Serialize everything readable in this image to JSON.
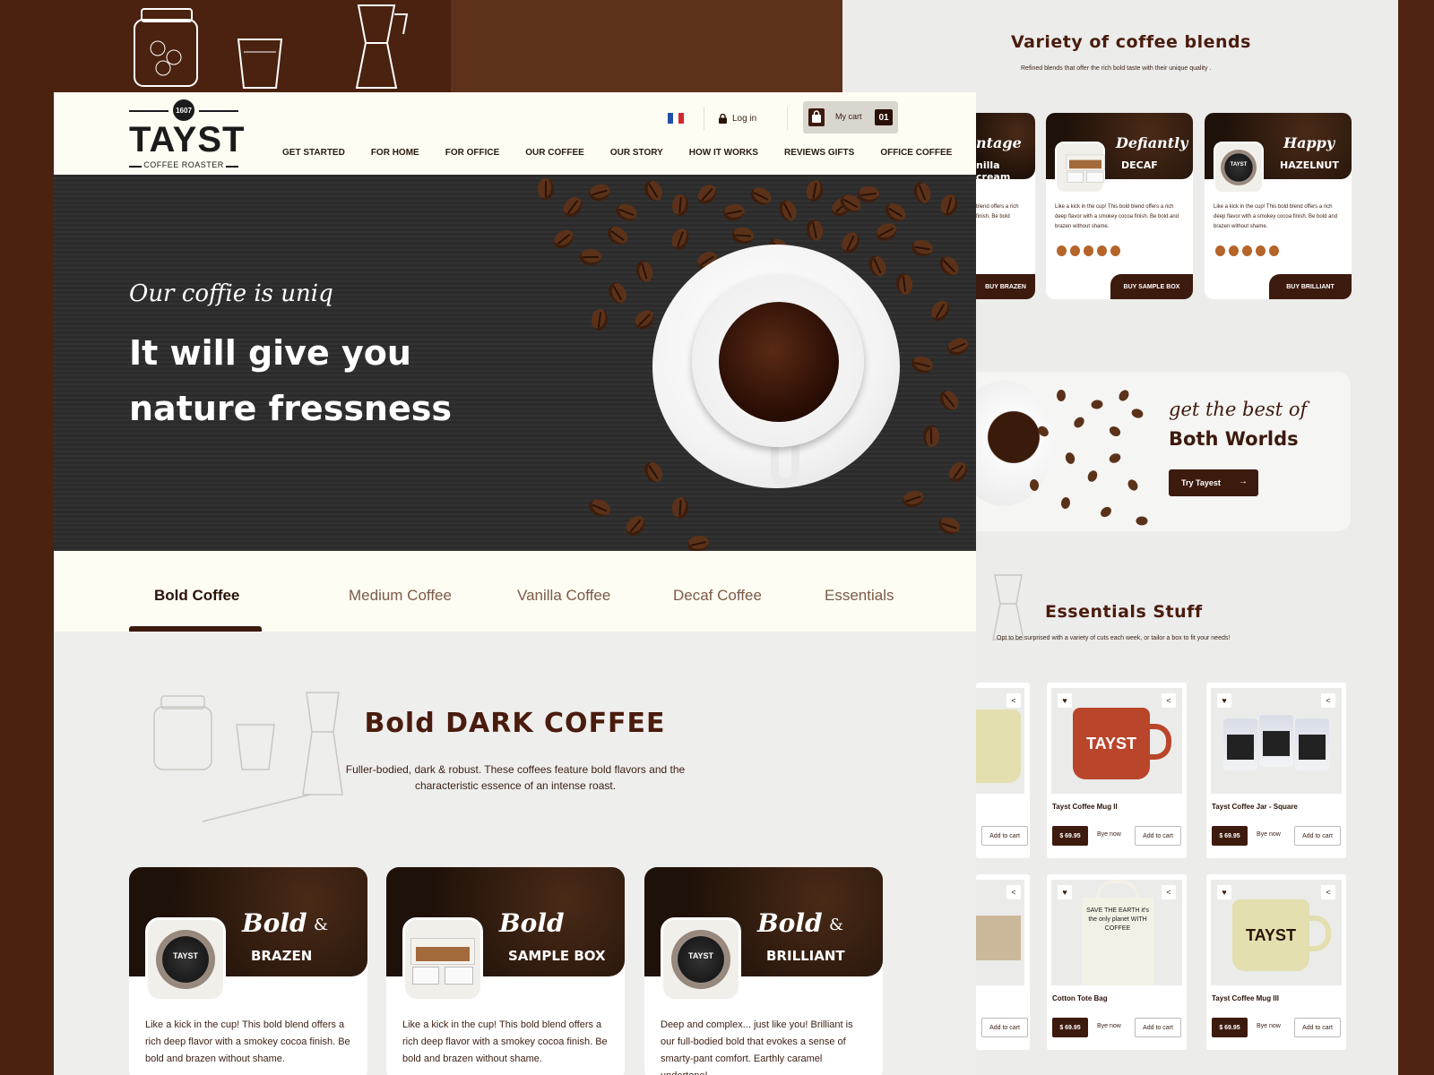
{
  "header": {
    "logo": {
      "badge": "1607",
      "name": "TAYST",
      "tagline": "COFFEE ROASTER"
    },
    "login_label": "Log in",
    "cart": {
      "label": "My cart",
      "count": "01"
    },
    "nav": [
      "GET STARTED",
      "FOR HOME",
      "FOR OFFICE",
      "OUR COFFEE",
      "OUR STORY",
      "HOW IT WORKS",
      "REVIEWS GIFTS",
      "OFFICE COFFEE"
    ]
  },
  "hero": {
    "tagline": "Our coffie is uniq",
    "headline": "It will give you nature fressness"
  },
  "tabs": [
    "Bold Coffee",
    "Medium Coffee",
    "Vanilla Coffee",
    "Decaf Coffee",
    "Essentials"
  ],
  "bold_section": {
    "title": "Bold  DARK COFFEE",
    "description": "Fuller-bodied, dark & robust. These coffees feature bold flavors and the characteristic essence of an intense roast.",
    "cards": [
      {
        "script": "Bold",
        "amp": "&",
        "name": "BRAZEN",
        "description": "Like a kick in the cup!  This bold blend offers a rich deep flavor with a smokey cocoa finish.  Be bold and brazen without shame."
      },
      {
        "script": "Bold",
        "amp": "",
        "name": "SAMPLE BOX",
        "description": "Like a kick in the cup!  This bold blend offers a rich deep flavor with a smokey cocoa finish.  Be bold and brazen without shame."
      },
      {
        "script": "Bold",
        "amp": "&",
        "name": "BRILLIANT",
        "description": "Deep and complex... just like you!  Brilliant is our full-bodied bold that evokes a sense of smarty-pant comfort. Earthly caramel undertone!"
      }
    ]
  },
  "variety": {
    "title": "Variety of coffee blends",
    "subtitle": "Refined blends that offer the rich bold taste with their unique quality .",
    "cards": [
      {
        "script": "ntage",
        "name": "nilla cream",
        "description": "blend offers a rich finish.  Be bold",
        "button": "BUY BRAZEN"
      },
      {
        "script": "Defiantly",
        "name": "DECAF",
        "description": "Like a kick in the cup!  This bold blend offers a rich deep flavor with a smokey cocoa finish.  Be bold and brazen without shame.",
        "button": "BUY SAMPLE BOX"
      },
      {
        "script": "Happy",
        "name": "HAZELNUT",
        "description": "Like a kick in the cup!  This bold blend offers a rich deep flavor with a smokey cocoa finish.  Be bold and brazen without shame.",
        "button": "BUY BRILLIANT"
      }
    ]
  },
  "promo": {
    "script_part": "get the best of",
    "bold_part": "Both Worlds",
    "button": "Try Tayest",
    "arrow": "→"
  },
  "essentials": {
    "title": "Essentials  Stuff",
    "subtitle": "Opt to be surprised with a variety of cuts each week, or tailor a box to fit your needs!",
    "price": "$ 69.95",
    "bye_label": "Bye now",
    "add_label": "Add to cart",
    "items": [
      {
        "title": ""
      },
      {
        "title": "Tayst Coffee Mug II"
      },
      {
        "title": "Tayst Coffee Jar - Square"
      },
      {
        "title": ""
      },
      {
        "title": "Cotton Tote Bag"
      },
      {
        "title": "Tayst Coffee Mug III"
      }
    ],
    "mug_text": "TAYST",
    "tote_text": "SAVE THE EARTH it's the only planet WITH COFFEE"
  },
  "colors": {
    "brand_dark": "#3d1a0e",
    "cream": "#fdfdf3",
    "bean": "#b5642a"
  },
  "icons": [
    "lock-icon",
    "cart-bag-icon",
    "heart-icon",
    "share-icon",
    "arrow-right-icon"
  ]
}
